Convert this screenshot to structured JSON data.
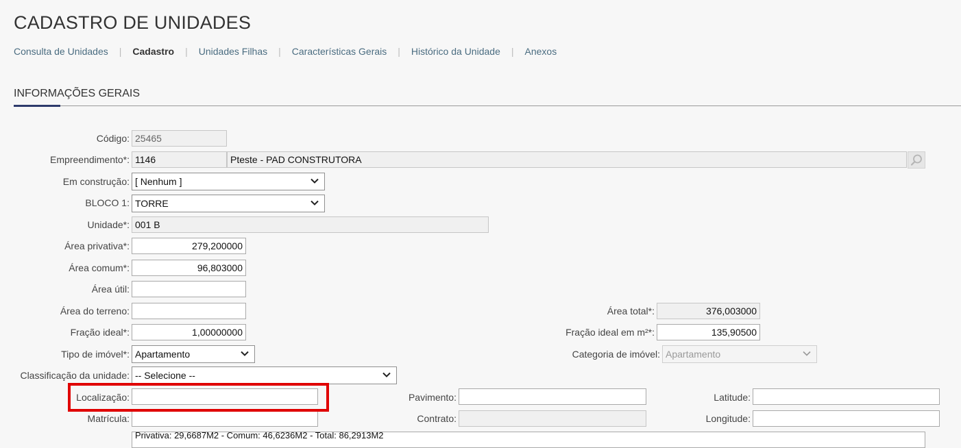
{
  "page": {
    "title": "CADASTRO DE UNIDADES",
    "tabs": [
      "Consulta de Unidades",
      "Cadastro",
      "Unidades Filhas",
      "Características Gerais",
      "Histórico da Unidade",
      "Anexos"
    ],
    "section_title": "INFORMAÇÕES GERAIS"
  },
  "form": {
    "codigo": {
      "label": "Código:",
      "value": "25465"
    },
    "empreendimento": {
      "label": "Empreendimento*:",
      "code": "1146",
      "name": "Pteste - PAD CONSTRUTORA"
    },
    "em_construcao": {
      "label": "Em construção:",
      "value": "[ Nenhum ]"
    },
    "bloco": {
      "label": "BLOCO 1:",
      "value": "TORRE"
    },
    "unidade": {
      "label": "Unidade*:",
      "value": "001 B"
    },
    "area_privativa": {
      "label": "Área privativa*:",
      "value": "279,200000"
    },
    "area_comum": {
      "label": "Área comum*:",
      "value": "96,803000"
    },
    "area_util": {
      "label": "Área útil:",
      "value": ""
    },
    "area_terreno": {
      "label": "Área do terreno:",
      "value": ""
    },
    "area_total": {
      "label": "Área total*:",
      "value": "376,003000"
    },
    "fracao_ideal": {
      "label": "Fração ideal*:",
      "value": "1,00000000"
    },
    "fracao_ideal_m2": {
      "label": "Fração ideal em m²*:",
      "value": "135,90500"
    },
    "tipo_imovel": {
      "label": "Tipo de imóvel*:",
      "value": "Apartamento"
    },
    "categoria_imovel": {
      "label": "Categoria de imóvel:",
      "value": "Apartamento"
    },
    "classificacao": {
      "label": "Classificação da unidade:",
      "value": "-- Selecione --"
    },
    "localizacao": {
      "label": "Localização:",
      "value": ""
    },
    "pavimento": {
      "label": "Pavimento:",
      "value": ""
    },
    "latitude": {
      "label": "Latitude:",
      "value": ""
    },
    "matricula": {
      "label": "Matrícula:",
      "value": ""
    },
    "contrato": {
      "label": "Contrato:",
      "value": ""
    },
    "longitude": {
      "label": "Longitude:",
      "value": ""
    },
    "summary_text": "Privativa: 29,6687M2 - Comum: 46,6236M2 - Total: 86,2913M2"
  },
  "icons": {
    "search": "magnifier-icon",
    "dropdown": "chevron-down-icon"
  },
  "colors": {
    "highlight": "#e00000",
    "accent": "#2d3a6b",
    "link": "#4a6c80"
  }
}
